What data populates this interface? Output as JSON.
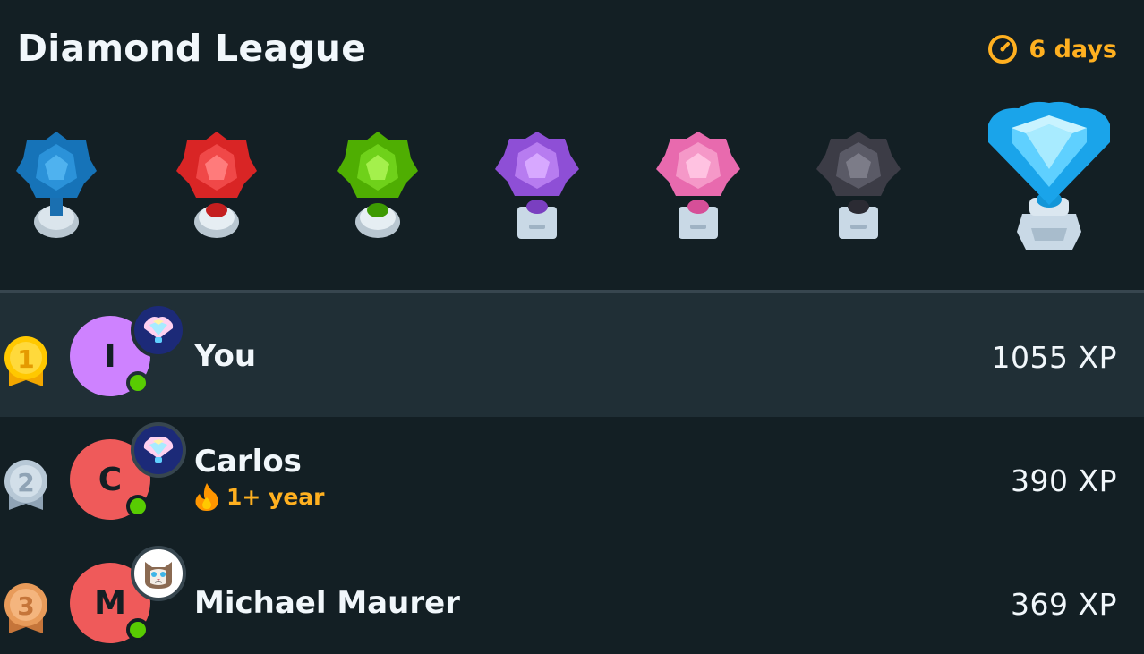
{
  "header": {
    "title": "Diamond League",
    "timer_text": "6 days",
    "accent_color": "#ffb020"
  },
  "trophies": [
    {
      "name": "sapphire-trophy-icon",
      "color": "#1f8dd6"
    },
    {
      "name": "ruby-trophy-icon",
      "color": "#e5342f"
    },
    {
      "name": "emerald-trophy-icon",
      "color": "#58cc02"
    },
    {
      "name": "amethyst-trophy-icon",
      "color": "#a560e8"
    },
    {
      "name": "pearl-trophy-icon",
      "color": "#ee7ab8"
    },
    {
      "name": "obsidian-trophy-icon",
      "color": "#4b4b55"
    },
    {
      "name": "diamond-trophy-icon",
      "color": "#1cb0f6"
    }
  ],
  "leaderboard": [
    {
      "rank": "1",
      "initial": "I",
      "name": "You",
      "xp": "1055 XP",
      "avatar_color": "#ce82ff",
      "badge": "diamond-league-badge-icon",
      "medal": "gold"
    },
    {
      "rank": "2",
      "initial": "C",
      "name": "Carlos",
      "streak": "1+ year",
      "xp": "390 XP",
      "avatar_color": "#ef5a5a",
      "badge": "diamond-league-badge-icon",
      "medal": "silver"
    },
    {
      "rank": "3",
      "initial": "M",
      "name": "Michael Maurer",
      "xp": "369 XP",
      "avatar_color": "#ef5a5a",
      "badge": "cat-badge-icon",
      "medal": "bronze"
    }
  ]
}
